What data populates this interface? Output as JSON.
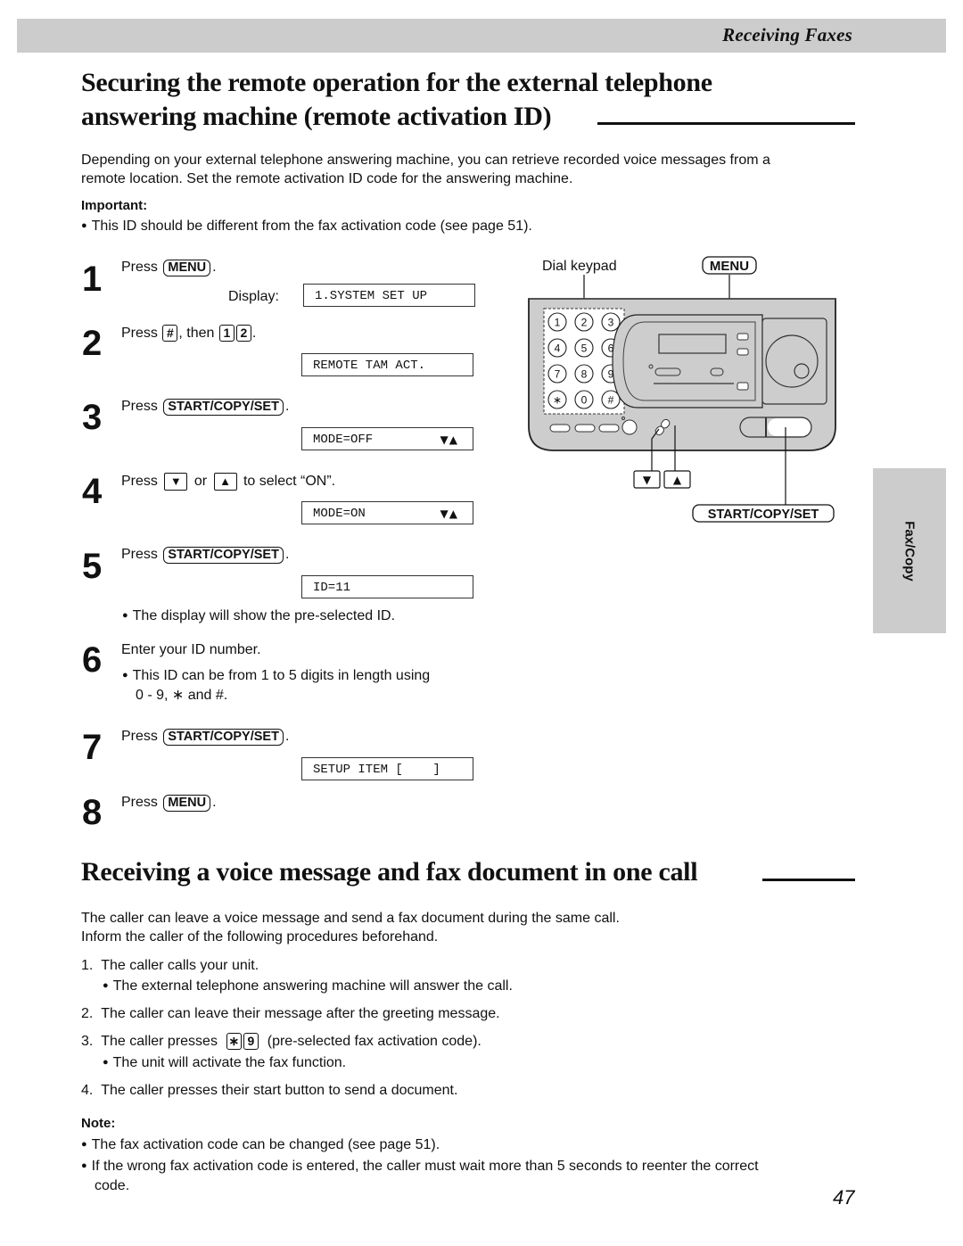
{
  "header": {
    "section_title": "Receiving Faxes"
  },
  "section1": {
    "heading_line1": "Securing the remote operation for the external telephone",
    "heading_line2": "answering machine (remote activation ID)",
    "intro_line1": "Depending on your external telephone answering machine, you can retrieve recorded voice messages from a",
    "intro_line2": "remote location. Set the remote activation ID code for the answering machine.",
    "important_label": "Important:",
    "important_note": "This ID should be different from the fax activation code (see page 51).",
    "steps": [
      {
        "num": "1",
        "press": "Press",
        "key": "MENU",
        "tail": ".",
        "display_label": "Display:",
        "display": "1.SYSTEM SET UP"
      },
      {
        "num": "2",
        "press": "Press",
        "key1": "#",
        "mid": ", then",
        "key2": "1",
        "key3": "2",
        "tail": ".",
        "display": "REMOTE TAM ACT."
      },
      {
        "num": "3",
        "press": "Press",
        "key": "START/COPY/SET",
        "tail": ".",
        "display": "MODE=OFF",
        "display_arrows": "▼▲"
      },
      {
        "num": "4",
        "press": "Press",
        "key1": "▼",
        "mid": "or",
        "key2": "▲",
        "tail": "to select “ON”.",
        "display": "MODE=ON",
        "display_arrows": "▼▲"
      },
      {
        "num": "5",
        "press": "Press",
        "key": "START/COPY/SET",
        "tail": ".",
        "display": "ID=11",
        "note": "The display will show the pre-selected ID."
      },
      {
        "num": "6",
        "text": "Enter your ID number.",
        "note_line1": "This ID can be from 1 to 5 digits in length using",
        "note_line2": "0 - 9, ∗ and #."
      },
      {
        "num": "7",
        "press": "Press",
        "key": "START/COPY/SET",
        "tail": ".",
        "display": "SETUP ITEM [    ]"
      },
      {
        "num": "8",
        "press": "Press",
        "key": "MENU",
        "tail": "."
      }
    ],
    "diagram": {
      "label_dial_keypad": "Dial keypad",
      "label_menu": "MENU",
      "label_down": "▼",
      "label_up": "▲",
      "label_start": "START/COPY/SET",
      "keypad": [
        "1",
        "2",
        "3",
        "4",
        "5",
        "6",
        "7",
        "8",
        "9",
        "∗",
        "0",
        "#"
      ]
    }
  },
  "side_tab": {
    "label": "Fax/Copy"
  },
  "section2": {
    "heading": "Receiving a voice message and fax document in one call",
    "intro_line1": "The caller can leave a voice message and send a fax document during the same call.",
    "intro_line2": "Inform the caller of the following procedures beforehand.",
    "items": [
      {
        "num": "1.",
        "text": "The caller calls your unit.",
        "note": "The external telephone answering machine will answer the call."
      },
      {
        "num": "2.",
        "text": "The caller can leave their message after the greeting message."
      },
      {
        "num": "3.",
        "text_before": "The caller presses",
        "key1": "∗",
        "key2": "9",
        "text_after": "(pre-selected fax activation code).",
        "note": "The unit will activate the fax function."
      },
      {
        "num": "4.",
        "text": "The caller presses their start button to send a document."
      }
    ],
    "note_label": "Note:",
    "notes": [
      "The fax activation code can be changed (see page 51).",
      "If the wrong fax activation code is entered, the caller must wait more than 5 seconds to reenter the correct"
    ],
    "notes_continuation": "code."
  },
  "footer": {
    "page_number": "47"
  }
}
